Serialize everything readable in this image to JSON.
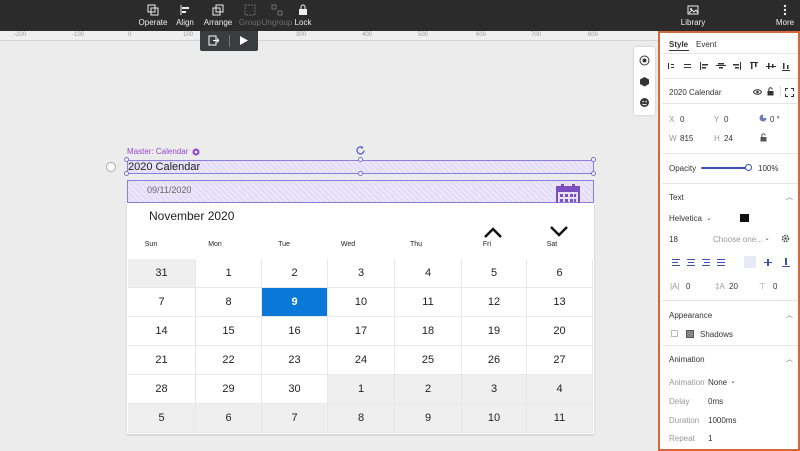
{
  "toolbar": {
    "operate": "Operate",
    "align": "Align",
    "arrange": "Arrange",
    "group": "Group",
    "ungroup": "Ungroup",
    "lock": "Lock",
    "library": "Library",
    "more": "More"
  },
  "ruler": [
    "-200",
    "-100",
    "0",
    "100",
    "200",
    "300",
    "400",
    "500",
    "600",
    "700",
    "800"
  ],
  "canvas": {
    "master_label": "Master: Calendar",
    "widget_name": "2020 Calendar",
    "date_value": "09/11/2020"
  },
  "calendar": {
    "month": "November 2020",
    "days": [
      "Sun",
      "Mon",
      "Tue",
      "Wed",
      "Thu",
      "Fri",
      "Sat"
    ],
    "weeks": [
      [
        "31",
        "1",
        "2",
        "3",
        "4",
        "5",
        "6"
      ],
      [
        "7",
        "8",
        "9",
        "10",
        "11",
        "12",
        "13"
      ],
      [
        "14",
        "15",
        "16",
        "17",
        "18",
        "19",
        "20"
      ],
      [
        "21",
        "22",
        "23",
        "24",
        "25",
        "26",
        "27"
      ],
      [
        "28",
        "29",
        "30",
        "1",
        "2",
        "3",
        "4"
      ],
      [
        "5",
        "6",
        "7",
        "8",
        "9",
        "10",
        "11"
      ]
    ],
    "selected": "9",
    "accent": "#0a78d6"
  },
  "panel": {
    "tab_style": "Style",
    "tab_event": "Event",
    "widget_name": "2020 Calendar",
    "x_label": "X",
    "x_value": "0",
    "y_label": "Y",
    "y_value": "0",
    "rotation": "0 °",
    "w_label": "W",
    "w_value": "815",
    "h_label": "H",
    "h_value": "24",
    "opacity_label": "Opacity",
    "opacity_value": "100%",
    "text_section": "Text",
    "font": "Helvetica",
    "font_size": "18",
    "font_style_placeholder": "Choose one...",
    "letter_spacing": "0",
    "line_height": "20",
    "para_spacing": "0",
    "appearance_section": "Appearance",
    "shadows": "Shadows",
    "animation_section": "Animation",
    "animation_label": "Animation",
    "animation_value": "None",
    "delay_label": "Delay",
    "delay_value": "0ms",
    "duration_label": "Duration",
    "duration_value": "1000ms",
    "repeat_label": "Repeat",
    "repeat_value": "1"
  },
  "colors": {
    "panel_border": "#d4683c",
    "selection": "#8a7fdc",
    "master": "#9a48d0"
  }
}
